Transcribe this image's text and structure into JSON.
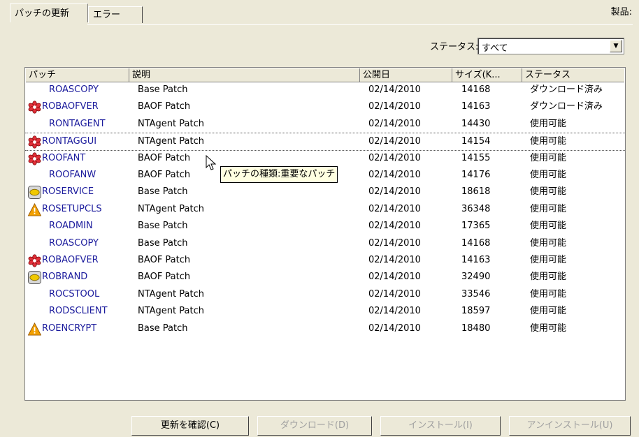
{
  "tabs": {
    "active": "パッチの更新",
    "inactive": "エラー"
  },
  "product_label": "製品:",
  "status_filter": {
    "label": "ステータス:",
    "value": "すべて"
  },
  "columns": [
    "パッチ",
    "説明",
    "公開日",
    "サイズ(K...",
    "ステータス"
  ],
  "rows": [
    {
      "icon": "none",
      "patch": "ROASCOPY",
      "desc": "Base Patch",
      "date": "02/14/2010",
      "size": "14168",
      "status": "ダウンロード済み"
    },
    {
      "icon": "critical",
      "patch": "ROBAOFVER",
      "desc": "BAOF Patch",
      "date": "02/14/2010",
      "size": "14163",
      "status": "ダウンロード済み"
    },
    {
      "icon": "none",
      "patch": "RONTAGENT",
      "desc": "NTAgent Patch",
      "date": "02/14/2010",
      "size": "14430",
      "status": "使用可能"
    },
    {
      "icon": "critical",
      "patch": "RONTAGGUI",
      "desc": "NTAgent Patch",
      "date": "02/14/2010",
      "size": "14154",
      "status": "使用可能"
    },
    {
      "icon": "critical",
      "patch": "ROOFANT",
      "desc": "BAOF Patch",
      "date": "02/14/2010",
      "size": "14155",
      "status": "使用可能"
    },
    {
      "icon": "none",
      "patch": "ROOFANW",
      "desc": "BAOF Patch",
      "date": "02/14/2010",
      "size": "14176",
      "status": "使用可能"
    },
    {
      "icon": "optional",
      "patch": "ROSERVICE",
      "desc": "Base Patch",
      "date": "02/14/2010",
      "size": "18618",
      "status": "使用可能"
    },
    {
      "icon": "warning",
      "patch": "ROSETUPCLS",
      "desc": "NTAgent Patch",
      "date": "02/14/2010",
      "size": "36348",
      "status": "使用可能"
    },
    {
      "icon": "none",
      "patch": "ROADMIN",
      "desc": "Base Patch",
      "date": "02/14/2010",
      "size": "17365",
      "status": "使用可能"
    },
    {
      "icon": "none",
      "patch": "ROASCOPY",
      "desc": "Base Patch",
      "date": "02/14/2010",
      "size": "14168",
      "status": "使用可能"
    },
    {
      "icon": "critical",
      "patch": "ROBAOFVER",
      "desc": "BAOF Patch",
      "date": "02/14/2010",
      "size": "14163",
      "status": "使用可能"
    },
    {
      "icon": "optional",
      "patch": "ROBRAND",
      "desc": "BAOF Patch",
      "date": "02/14/2010",
      "size": "32490",
      "status": "使用可能"
    },
    {
      "icon": "none",
      "patch": "ROCSTOOL",
      "desc": "NTAgent Patch",
      "date": "02/14/2010",
      "size": "33546",
      "status": "使用可能"
    },
    {
      "icon": "none",
      "patch": "RODSCLIENT",
      "desc": "NTAgent Patch",
      "date": "02/14/2010",
      "size": "18597",
      "status": "使用可能"
    },
    {
      "icon": "warning",
      "patch": "ROENCRYPT",
      "desc": "Base Patch",
      "date": "02/14/2010",
      "size": "18480",
      "status": "使用可能"
    }
  ],
  "tooltip": "パッチの種類:重要なパッチ",
  "buttons": {
    "check": "更新を確認(C)",
    "download": "ダウンロード(D)",
    "install": "インストール(I)",
    "uninstall": "アンインストール(U)"
  }
}
